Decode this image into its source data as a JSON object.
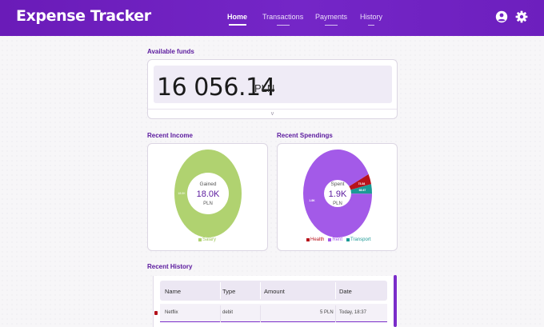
{
  "app": {
    "title": "Expense Tracker"
  },
  "nav": [
    {
      "label": "Home",
      "active": true
    },
    {
      "label": "Transactions",
      "active": false
    },
    {
      "label": "Payments",
      "active": false
    },
    {
      "label": "History",
      "active": false
    }
  ],
  "header_icons": [
    "account-circle-icon",
    "gear-icon"
  ],
  "funds": {
    "title": "Available funds",
    "amount": "16 056.14",
    "currency": "PLN",
    "expand_glyph": "v"
  },
  "income": {
    "title": "Recent Income",
    "center_label": "Gained",
    "center_value": "18.0K",
    "center_unit": "PLN",
    "slices": [
      {
        "name": "Salary",
        "value": 18000,
        "label": "18.0K",
        "color": "#b0d270"
      }
    ],
    "legend": [
      {
        "name": "Salary",
        "color": "#b0d270"
      }
    ]
  },
  "spendings": {
    "title": "Recent Spendings",
    "center_label": "Spent",
    "center_value": "1.9K",
    "center_unit": "PLN",
    "slices": [
      {
        "name": "Health",
        "value": 73.84,
        "label": "73.84",
        "color": "#b8121b"
      },
      {
        "name": "Transport",
        "value": 68.67,
        "label": "68.67",
        "color": "#1c9a96"
      },
      {
        "name": "Rent",
        "value": 1800,
        "label": "1.8K",
        "color": "#a35ae8"
      }
    ],
    "legend": [
      {
        "name": "Health",
        "color": "#b8121b"
      },
      {
        "name": "Rent",
        "color": "#a35ae8"
      },
      {
        "name": "Transport",
        "color": "#1c9a96"
      }
    ]
  },
  "history": {
    "title": "Recent History",
    "columns": [
      "Name",
      "Type",
      "Amount",
      "Date"
    ],
    "rows": [
      {
        "name": "Netflix",
        "type": "debit",
        "amount": "5 PLN",
        "date": "Today, 18:37",
        "indicator_color": "#b3121b"
      }
    ]
  },
  "colors": {
    "accent": "#6a1bb8",
    "header": "#7426c7",
    "section_title": "#5b1a9e"
  }
}
